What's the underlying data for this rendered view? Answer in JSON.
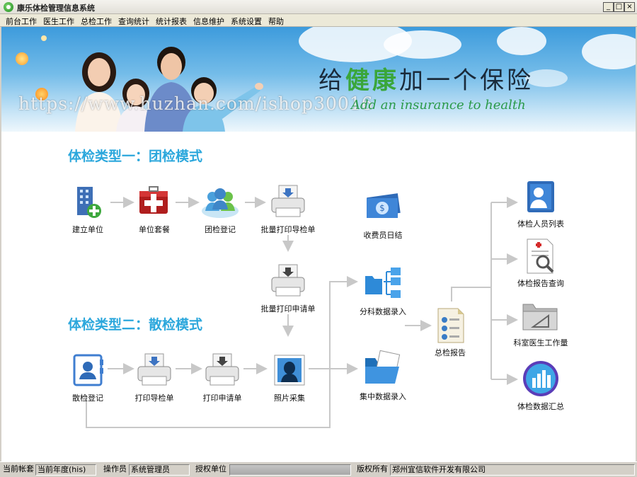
{
  "window": {
    "title": "康乐体检管理信息系统",
    "buttons": {
      "minimize": "_",
      "maximize": "□",
      "close": "×"
    }
  },
  "menu": [
    "前台工作",
    "医生工作",
    "总检工作",
    "查询统计",
    "统计报表",
    "信息维护",
    "系统设置",
    "帮助"
  ],
  "banner": {
    "slogan_cn_before": "给",
    "slogan_cn_highlight": "健康",
    "slogan_cn_after": "加一个保险",
    "slogan_en": "Add an insurance to health",
    "watermark": "https://www.huzhan.com/ishop30016"
  },
  "sections": {
    "group_mode_title": "体检类型一：团检模式",
    "individual_mode_title": "体检类型二：散检模式"
  },
  "workflow": {
    "create_unit": "建立单位",
    "unit_package": "单位套餐",
    "group_register": "团检登记",
    "batch_print_guide": "批量打印导检单",
    "cashier_daily": "收费员日结",
    "batch_print_request": "批量打印申请单",
    "dept_data_entry": "分科数据录入",
    "individual_register": "散检登记",
    "print_guide": "打印导检单",
    "print_request": "打印申请单",
    "photo_capture": "照片采集",
    "central_data_entry": "集中数据录入",
    "final_report": "总检报告",
    "exam_person_list": "体检人员列表",
    "report_query": "体检报告查询",
    "doctor_workload": "科室医生工作量",
    "data_summary": "体检数据汇总"
  },
  "icons": {
    "create_unit": "building-add-icon",
    "unit_package": "medical-kit-icon",
    "group_register": "group-people-icon",
    "batch_print_guide": "printer-icon",
    "cashier_daily": "money-icon",
    "batch_print_request": "printer-icon",
    "dept_data_entry": "folder-tree-icon",
    "individual_register": "contact-card-icon",
    "print_guide": "printer-icon",
    "print_request": "printer-icon",
    "photo_capture": "photo-icon",
    "central_data_entry": "open-folder-icon",
    "final_report": "report-document-icon",
    "exam_person_list": "person-list-icon",
    "report_query": "report-search-icon",
    "doctor_workload": "folder-chart-icon",
    "data_summary": "bar-chart-disc-icon"
  },
  "status": {
    "account_label": "当前帐套",
    "account_value": "当前年度(his)",
    "operator_label": "操作员",
    "operator_value": "系统管理员",
    "auth_label": "授权单位",
    "auth_value": "",
    "copyright_label": "版权所有",
    "copyright_value": "郑州宜信软件开发有限公司"
  },
  "colors": {
    "section_title": "#2ba7dc",
    "slogan_highlight": "#3aa63a",
    "arrow": "#c8c8c8",
    "window_bg": "#d4d0c8"
  }
}
